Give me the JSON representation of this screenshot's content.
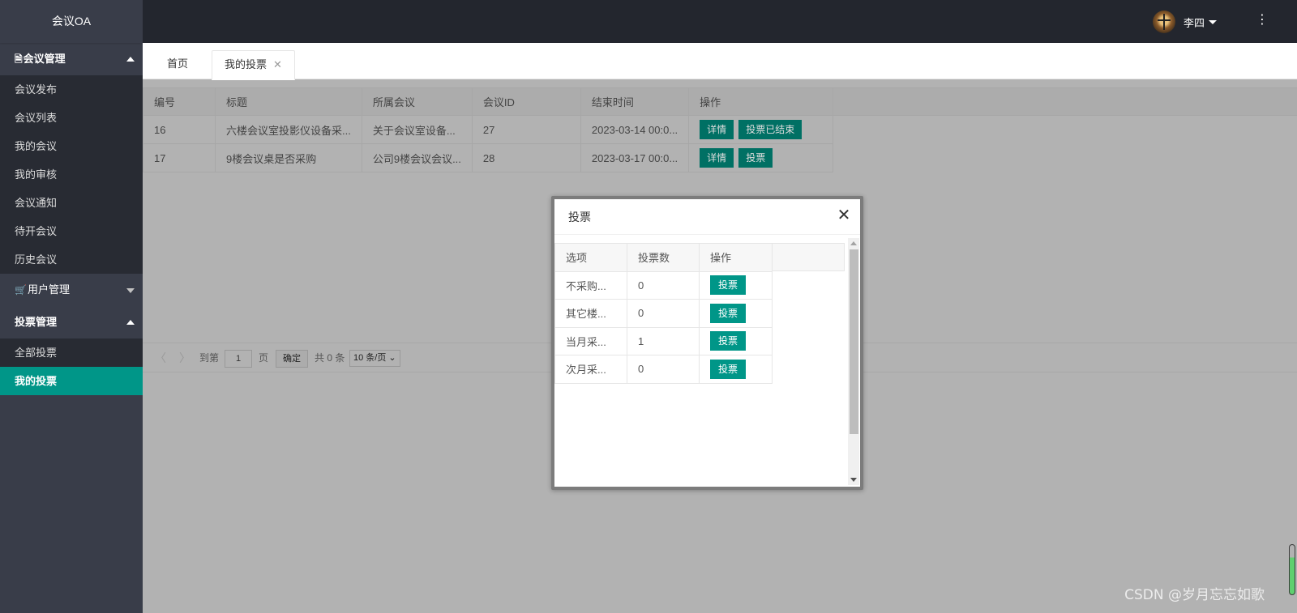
{
  "app": {
    "title": "会议OA"
  },
  "sidebar": {
    "groups": [
      {
        "label": "会议管理",
        "icon": "document-icon",
        "open": true,
        "items": [
          "会议发布",
          "会议列表",
          "我的会议",
          "我的审核",
          "会议通知",
          "待开会议",
          "历史会议"
        ]
      },
      {
        "label": "用户管理",
        "icon": "cart-icon",
        "open": false,
        "items": []
      },
      {
        "label": "投票管理",
        "icon": "",
        "open": true,
        "items": [
          "全部投票",
          "我的投票"
        ],
        "active": "我的投票"
      }
    ]
  },
  "header": {
    "user_name": "李四",
    "more_icon": "⋮"
  },
  "tabs": {
    "home": "首页",
    "current": "我的投票",
    "close": "✕"
  },
  "table": {
    "columns": [
      "编号",
      "标题",
      "所属会议",
      "会议ID",
      "结束时间",
      "操作"
    ],
    "rows": [
      {
        "id": "16",
        "title": "六楼会议室投影仪设备采...",
        "meeting": "关于会议室设备...",
        "meeting_id": "27",
        "end_time": "2023-03-14 00:0...",
        "actions": [
          "详情",
          "投票已结束"
        ]
      },
      {
        "id": "17",
        "title": "9楼会议桌是否采购",
        "meeting": "公司9楼会议会议...",
        "meeting_id": "28",
        "end_time": "2023-03-17 00:0...",
        "actions": [
          "详情",
          "投票"
        ]
      }
    ]
  },
  "pager": {
    "prev": "〈",
    "next": "〉",
    "goto": "到第",
    "page": "1",
    "page_unit": "页",
    "confirm": "确定",
    "total": "共 0 条",
    "page_size": "10 条/页"
  },
  "modal": {
    "title": "投票",
    "close": "✕",
    "columns": [
      "选项",
      "投票数",
      "操作"
    ],
    "rows": [
      {
        "option": "不采购...",
        "count": "0",
        "action": "投票"
      },
      {
        "option": "其它楼...",
        "count": "0",
        "action": "投票"
      },
      {
        "option": "当月采...",
        "count": "1",
        "action": "投票"
      },
      {
        "option": "次月采...",
        "count": "0",
        "action": "投票"
      }
    ]
  },
  "watermark": "CSDN @岁月忘忘如歌"
}
